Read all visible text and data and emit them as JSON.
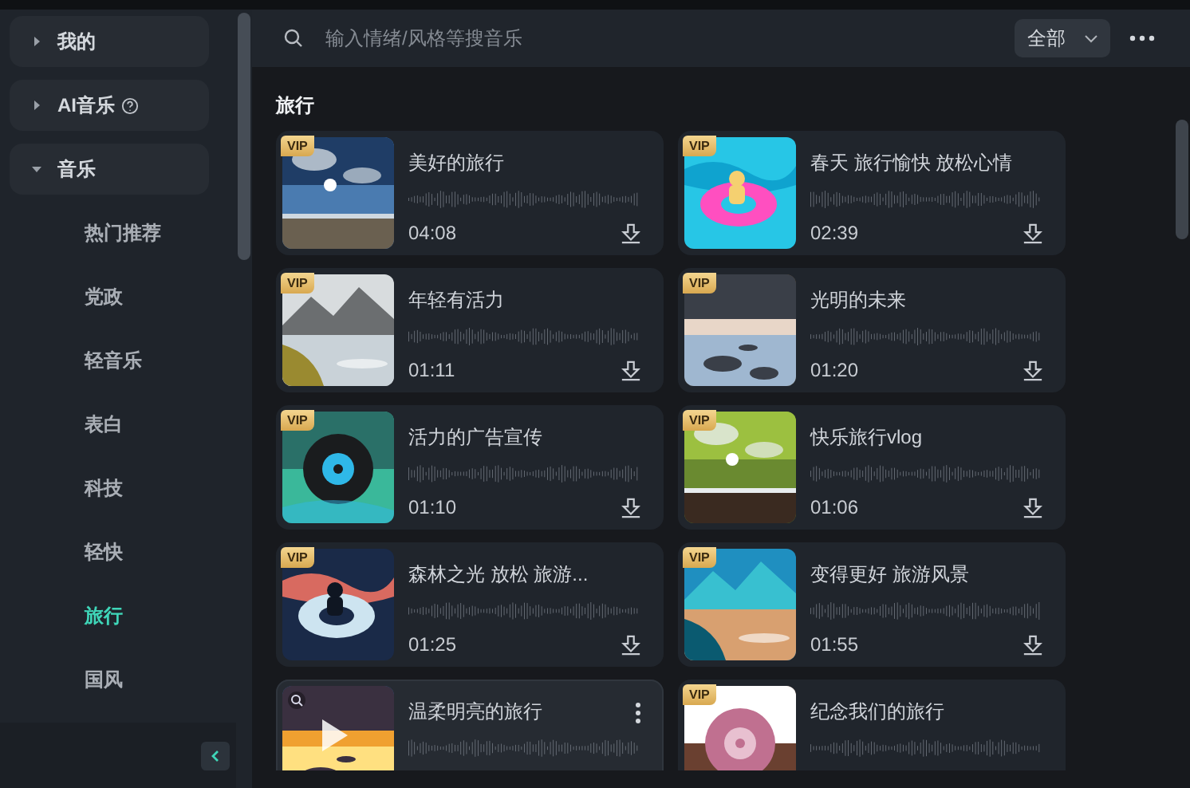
{
  "sidebar": {
    "groups": [
      {
        "label": "我的",
        "expanded": false,
        "help": false
      },
      {
        "label": "AI音乐",
        "expanded": false,
        "help": true
      },
      {
        "label": "音乐",
        "expanded": true,
        "help": false,
        "children": [
          {
            "label": "热门推荐",
            "selected": false
          },
          {
            "label": "党政",
            "selected": false
          },
          {
            "label": "轻音乐",
            "selected": false
          },
          {
            "label": "表白",
            "selected": false
          },
          {
            "label": "科技",
            "selected": false
          },
          {
            "label": "轻快",
            "selected": false
          },
          {
            "label": "旅行",
            "selected": true
          },
          {
            "label": "国风",
            "selected": false
          }
        ]
      }
    ]
  },
  "search": {
    "placeholder": "输入情绪/风格等搜音乐"
  },
  "filter": {
    "value": "全部"
  },
  "section": {
    "title": "旅行"
  },
  "tracks": [
    {
      "title": "美好的旅行",
      "duration": "04:08",
      "badge": "VIP",
      "hovered": false
    },
    {
      "title": "春天 旅行愉快 放松心情",
      "duration": "02:39",
      "badge": "VIP",
      "hovered": false
    },
    {
      "title": "年轻有活力",
      "duration": "01:11",
      "badge": "VIP",
      "hovered": false
    },
    {
      "title": "光明的未来",
      "duration": "01:20",
      "badge": "VIP",
      "hovered": false
    },
    {
      "title": "活力的广告宣传",
      "duration": "01:10",
      "badge": "VIP",
      "hovered": false
    },
    {
      "title": "快乐旅行vlog",
      "duration": "01:06",
      "badge": "VIP",
      "hovered": false
    },
    {
      "title": "森林之光  放松  旅游...",
      "duration": "01:25",
      "badge": "VIP",
      "hovered": false
    },
    {
      "title": "变得更好 旅游风景",
      "duration": "01:55",
      "badge": "VIP",
      "hovered": false
    },
    {
      "title": "温柔明亮的旅行",
      "hovered": true
    },
    {
      "title": "纪念我们的旅行",
      "badge": "VIP",
      "hovered": false
    }
  ]
}
